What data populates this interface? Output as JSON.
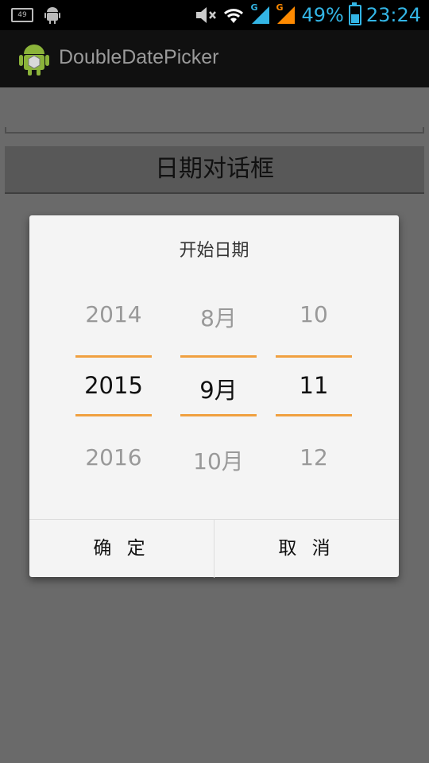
{
  "status_bar": {
    "notification_count": "49",
    "network_label_1": "G",
    "network_label_2": "G",
    "battery": "49%",
    "time": "23:24",
    "icons": [
      "notification-box-icon",
      "android-icon",
      "mute-icon",
      "wifi-icon",
      "signal-icon",
      "battery-icon"
    ],
    "accent_color": "#33b5e5"
  },
  "action_bar": {
    "title": "DoubleDatePicker",
    "icon": "android-app-icon"
  },
  "main": {
    "dialog_button_label": "日期对话框"
  },
  "dialog": {
    "title": "开始日期",
    "year": {
      "prev": "2014",
      "current": "2015",
      "next": "2016"
    },
    "month": {
      "prev": "8月",
      "current": "9月",
      "next": "10月"
    },
    "day": {
      "prev": "10",
      "current": "11",
      "next": "12"
    },
    "divider_color": "#f0a040",
    "confirm_label": "确 定",
    "cancel_label": "取 消"
  }
}
